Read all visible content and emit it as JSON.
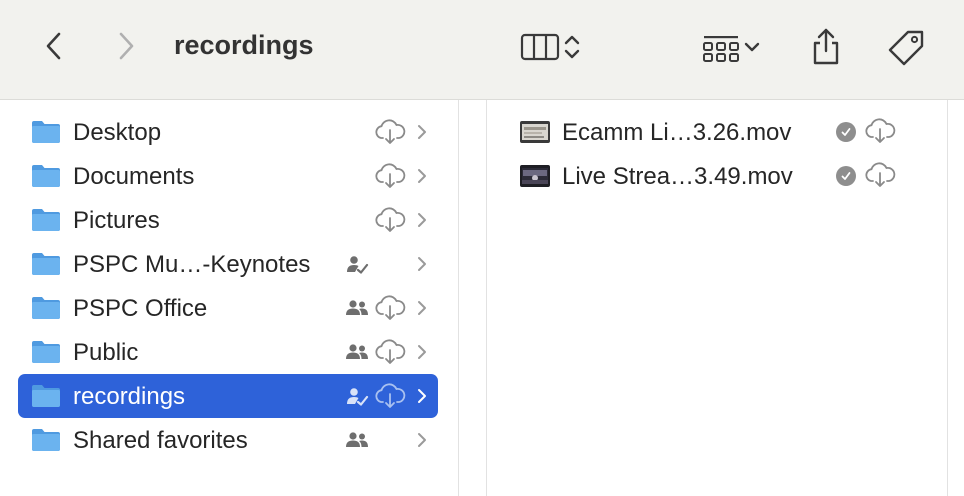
{
  "toolbar": {
    "title": "recordings",
    "back_icon": "chevron-left-icon",
    "forward_icon": "chevron-right-icon",
    "view_icon": "column-view-icon",
    "group_icon": "group-grid-icon",
    "share_icon": "share-icon",
    "tag_icon": "tag-icon"
  },
  "sidebar": {
    "items": [
      {
        "label": "Desktop",
        "status": "icloud-download"
      },
      {
        "label": "Documents",
        "status": "icloud-download"
      },
      {
        "label": "Pictures",
        "status": "icloud-download"
      },
      {
        "label": "PSPC Mu…-Keynotes",
        "status": "shared-by-me"
      },
      {
        "label": "PSPC Office",
        "status": "shared-icloud-download"
      },
      {
        "label": "Public",
        "status": "shared-icloud-download"
      },
      {
        "label": "recordings",
        "status": "shared-by-me-icloud-download",
        "selected": true
      },
      {
        "label": "Shared favorites",
        "status": "shared"
      }
    ]
  },
  "files": {
    "items": [
      {
        "label": "Ecamm Li…3.26.mov",
        "status": "downloaded-icloud"
      },
      {
        "label": "Live Strea…3.49.mov",
        "status": "downloaded-icloud"
      }
    ]
  },
  "colors": {
    "selection": "#2e62d9",
    "folder": "#5aa5e6",
    "toolbar_bg": "#f2f2ee"
  }
}
